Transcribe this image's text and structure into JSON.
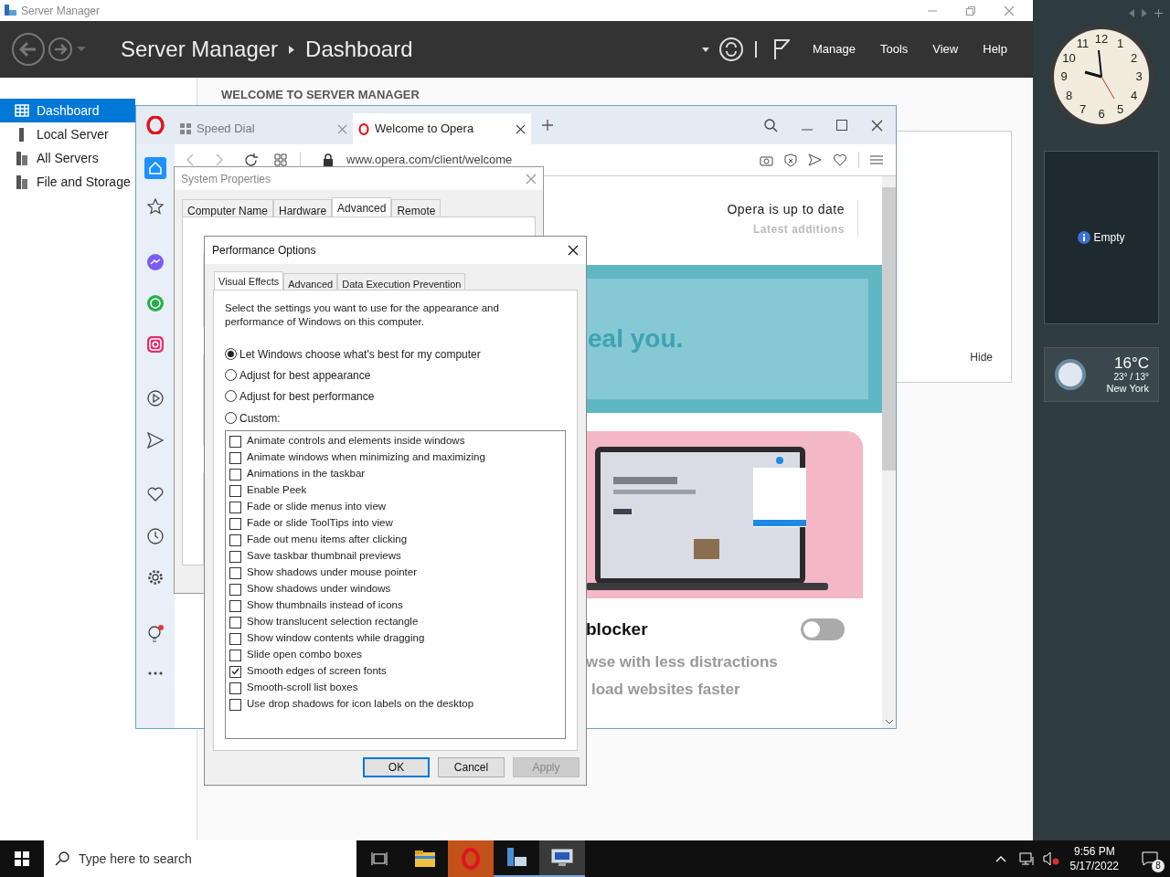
{
  "server_manager": {
    "title": "Server Manager",
    "breadcrumb": [
      "Server Manager",
      "Dashboard"
    ],
    "menu": [
      "Manage",
      "Tools",
      "View",
      "Help"
    ],
    "sidebar": [
      {
        "label": "Dashboard",
        "selected": true
      },
      {
        "label": "Local Server",
        "selected": false
      },
      {
        "label": "All Servers",
        "selected": false
      },
      {
        "label": "File and Storage",
        "selected": false
      }
    ],
    "welcome_heading": "WELCOME TO SERVER MANAGER",
    "hide": "Hide"
  },
  "opera": {
    "tabs": [
      {
        "label": "Speed Dial",
        "selected": false
      },
      {
        "label": "Welcome to Opera",
        "selected": true
      }
    ],
    "address": "www.opera.com/client/welcome",
    "update_title": "Opera is up to date",
    "update_link": "Latest additions",
    "banner_text": "eal you.",
    "feature_title": "blocker",
    "feature_on": false,
    "feature_lines": [
      "wse with less distractions",
      "load websites faster"
    ]
  },
  "system_properties": {
    "title": "System Properties",
    "tabs": [
      {
        "label": "Computer Name",
        "selected": false
      },
      {
        "label": "Hardware",
        "selected": false
      },
      {
        "label": "Advanced",
        "selected": true
      },
      {
        "label": "Remote",
        "selected": false
      }
    ]
  },
  "performance_options": {
    "title": "Performance Options",
    "tabs": [
      {
        "label": "Visual Effects",
        "selected": true
      },
      {
        "label": "Advanced",
        "selected": false
      },
      {
        "label": "Data Execution Prevention",
        "selected": false
      }
    ],
    "intro": "Select the settings you want to use for the appearance and performance of Windows on this computer.",
    "radios": [
      {
        "label": "Let Windows choose what's best for my computer",
        "selected": true
      },
      {
        "label": "Adjust for best appearance",
        "selected": false
      },
      {
        "label": "Adjust for best performance",
        "selected": false
      },
      {
        "label": "Custom:",
        "selected": false
      }
    ],
    "effects": [
      {
        "label": "Animate controls and elements inside windows",
        "checked": false
      },
      {
        "label": "Animate windows when minimizing and maximizing",
        "checked": false
      },
      {
        "label": "Animations in the taskbar",
        "checked": false
      },
      {
        "label": "Enable Peek",
        "checked": false
      },
      {
        "label": "Fade or slide menus into view",
        "checked": false
      },
      {
        "label": "Fade or slide ToolTips into view",
        "checked": false
      },
      {
        "label": "Fade out menu items after clicking",
        "checked": false
      },
      {
        "label": "Save taskbar thumbnail previews",
        "checked": false
      },
      {
        "label": "Show shadows under mouse pointer",
        "checked": false
      },
      {
        "label": "Show shadows under windows",
        "checked": false
      },
      {
        "label": "Show thumbnails instead of icons",
        "checked": false
      },
      {
        "label": "Show translucent selection rectangle",
        "checked": false
      },
      {
        "label": "Show window contents while dragging",
        "checked": false
      },
      {
        "label": "Slide open combo boxes",
        "checked": false
      },
      {
        "label": "Smooth edges of screen fonts",
        "checked": true
      },
      {
        "label": "Smooth-scroll list boxes",
        "checked": false
      },
      {
        "label": "Use drop shadows for icon labels on the desktop",
        "checked": false
      }
    ],
    "buttons": [
      {
        "label": "OK",
        "kind": "default",
        "disabled": false
      },
      {
        "label": "Cancel",
        "kind": "normal",
        "disabled": false
      },
      {
        "label": "Apply",
        "kind": "normal",
        "disabled": true
      }
    ]
  },
  "gadgets": {
    "clock_numerals": [
      "11",
      "12",
      "1",
      "10",
      "2",
      "9",
      "3",
      "8",
      "4",
      "7",
      "6",
      "5"
    ],
    "slideshow": "Empty",
    "weather": {
      "temperature": "16°C",
      "range": "23° / 13°",
      "city": "New York"
    }
  },
  "taskbar": {
    "search_placeholder": "Type here to search",
    "time": "9:56 PM",
    "date": "5/17/2022",
    "notifications": "8"
  }
}
